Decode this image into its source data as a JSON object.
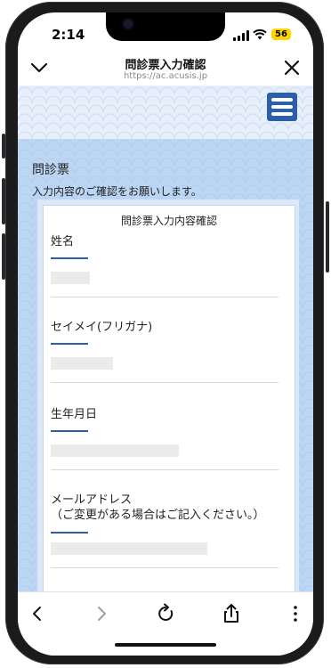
{
  "status_bar": {
    "time": "2:14",
    "battery": "56"
  },
  "browser_nav": {
    "title": "問診票入力確認",
    "url": "https://ac.acusis.jp"
  },
  "page": {
    "heading": "問診票",
    "instruction": "入力内容のご確認をお願いします。",
    "card_title": "問診票入力内容確認",
    "fields": [
      {
        "label": "姓名"
      },
      {
        "label": "セイメイ(フリガナ)"
      },
      {
        "label": "生年月日"
      },
      {
        "label": "メールアドレス\n（ご変更がある場合はご記入ください。）"
      }
    ]
  },
  "colors": {
    "accent": "#2c5fa8",
    "background": "#bcd6f3",
    "battery": "#ffd400"
  }
}
